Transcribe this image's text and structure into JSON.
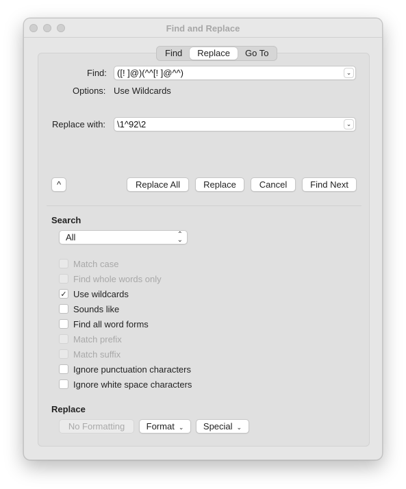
{
  "window": {
    "title": "Find and Replace"
  },
  "tabs": [
    {
      "label": "Find",
      "active": false
    },
    {
      "label": "Replace",
      "active": true
    },
    {
      "label": "Go To",
      "active": false
    }
  ],
  "find": {
    "label": "Find:",
    "value": "([! ]@)(^^[! ]@^^)"
  },
  "options": {
    "label": "Options:",
    "value": "Use Wildcards"
  },
  "replace_with": {
    "label": "Replace with:",
    "value": "\\1^92\\2"
  },
  "buttons": {
    "collapse": "^",
    "replace_all": "Replace All",
    "replace": "Replace",
    "cancel": "Cancel",
    "find_next": "Find Next"
  },
  "search": {
    "heading": "Search",
    "scope": "All"
  },
  "checkboxes": [
    {
      "label": "Match case",
      "checked": false,
      "enabled": false
    },
    {
      "label": "Find whole words only",
      "checked": false,
      "enabled": false
    },
    {
      "label": "Use wildcards",
      "checked": true,
      "enabled": true
    },
    {
      "label": "Sounds like",
      "checked": false,
      "enabled": true
    },
    {
      "label": "Find all word forms",
      "checked": false,
      "enabled": true
    },
    {
      "label": "Match prefix",
      "checked": false,
      "enabled": false
    },
    {
      "label": "Match suffix",
      "checked": false,
      "enabled": false
    },
    {
      "label": "Ignore punctuation characters",
      "checked": false,
      "enabled": true
    },
    {
      "label": "Ignore white space characters",
      "checked": false,
      "enabled": true
    }
  ],
  "replace_section": {
    "heading": "Replace",
    "no_formatting": "No Formatting",
    "format": "Format",
    "special": "Special"
  }
}
